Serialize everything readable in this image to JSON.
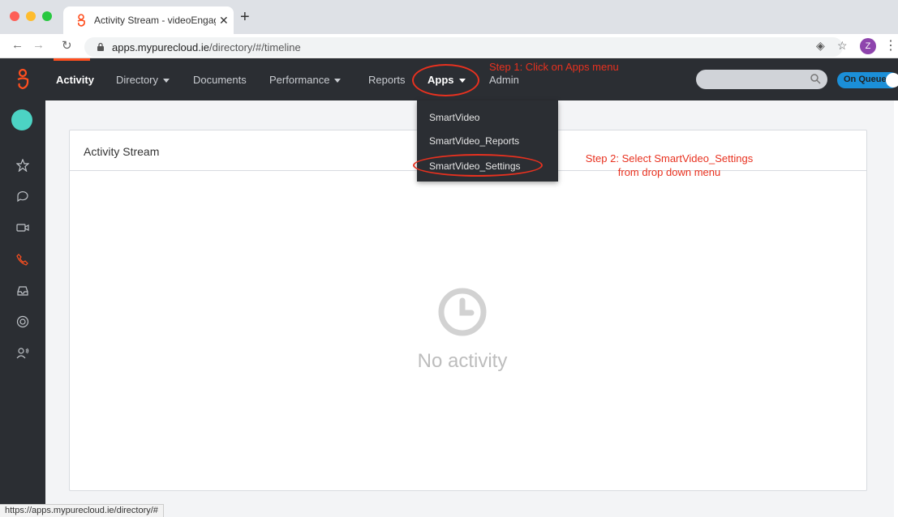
{
  "browser": {
    "tab_title": "Activity Stream - videoEngager",
    "url_host": "apps.mypurecloud.ie",
    "url_path": "/directory/#/timeline",
    "profile_initial": "Z",
    "status_url": "https://apps.mypurecloud.ie/directory/#"
  },
  "nav": {
    "activity": "Activity",
    "directory": "Directory",
    "documents": "Documents",
    "performance": "Performance",
    "reports": "Reports",
    "apps": "Apps",
    "admin": "Admin"
  },
  "queue": {
    "label": "On Queue"
  },
  "apps_menu": {
    "items": [
      "SmartVideo",
      "SmartVideo_Reports",
      "SmartVideo_Settings"
    ]
  },
  "panel": {
    "title": "Activity Stream",
    "empty_text": "No activity"
  },
  "annotations": {
    "step1": "Step 1: Click on Apps menu",
    "step2_line1": "Step 2: Select SmartVideo_Settings",
    "step2_line2": "from drop down menu"
  },
  "colors": {
    "accent": "#ff4f1f",
    "header_bg": "#2b2e33",
    "queue_blue": "#1b8fd8",
    "annotation_red": "#e8311f"
  },
  "icons": [
    "close-icon",
    "plus-icon",
    "back-arrow-icon",
    "forward-arrow-icon",
    "reload-icon",
    "lock-icon",
    "location-icon",
    "star-icon",
    "more-icon",
    "search-icon",
    "clock-icon",
    "chat-icon",
    "video-icon",
    "phone-icon",
    "inbox-icon",
    "support-icon",
    "people-icon"
  ]
}
